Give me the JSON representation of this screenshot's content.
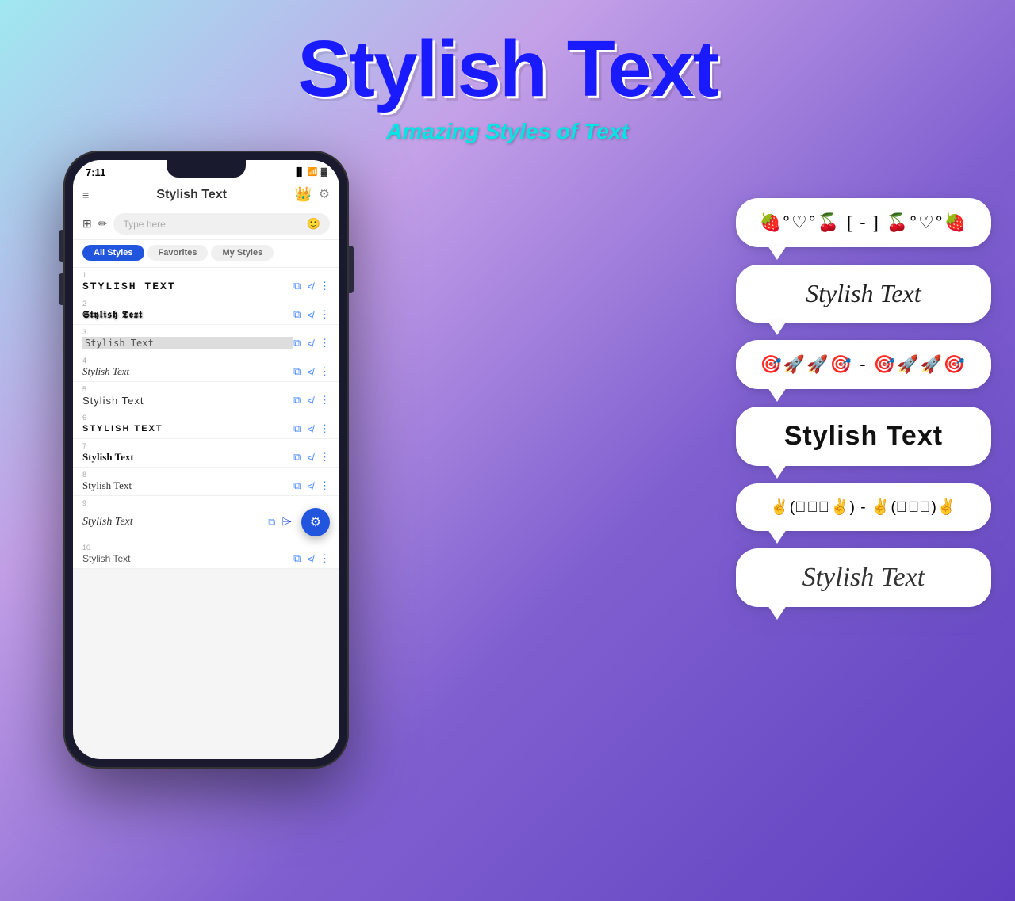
{
  "header": {
    "title": "Stylish Text",
    "subtitle": "Amazing Styles of Text"
  },
  "phone": {
    "status_time": "7:11",
    "app_name": "Stylish Text",
    "search_placeholder": "Type here",
    "tabs": [
      "All Styles",
      "Favorites",
      "My Styles"
    ],
    "styles": [
      {
        "num": "1",
        "text": "STYLISH TEXT",
        "class": "style-1"
      },
      {
        "num": "2",
        "text": "𝕾𝖙𝖞𝖑𝖎𝖘𝖍 𝕿𝖊𝖝𝖙",
        "class": "style-2"
      },
      {
        "num": "3",
        "text": "Stylish Text",
        "class": "style-3"
      },
      {
        "num": "4",
        "text": "Stylish Text",
        "class": "style-4"
      },
      {
        "num": "5",
        "text": "Stylish Text",
        "class": "style-5"
      },
      {
        "num": "6",
        "text": "STYLISH TEXT",
        "class": "style-6"
      },
      {
        "num": "7",
        "text": "Stylish Text",
        "class": "style-7"
      },
      {
        "num": "8",
        "text": "Stylish Text",
        "class": "style-8"
      },
      {
        "num": "9",
        "text": "Stylish Text",
        "class": "style-9"
      },
      {
        "num": "10",
        "text": "Stylish Text",
        "class": "style-10"
      }
    ]
  },
  "bubbles": [
    {
      "id": 1,
      "content": "🍓°♡°🍒 [ - ] 🍒°♡°🍓",
      "class": "bubble-text-1"
    },
    {
      "id": 2,
      "content": "Stylish Text",
      "class": "bubble-text-2"
    },
    {
      "id": 3,
      "content": "🎯🚀🚀🎯 - 🎯🚀🚀🎯",
      "class": "bubble-text-3"
    },
    {
      "id": 4,
      "content": "Stylish Text",
      "class": "bubble-text-4"
    },
    {
      "id": 5,
      "content": "✌(ﾟ◡ﾟ✌) - ✌(ﾟ◡ﾟ)✌",
      "class": "bubble-text-5"
    },
    {
      "id": 6,
      "content": "Stylish Text",
      "class": "bubble-text-6"
    }
  ],
  "colors": {
    "bg_start": "#a0e8f0",
    "bg_end": "#6040c0",
    "title_blue": "#1a1aff",
    "subtitle_cyan": "#00e5e5",
    "tab_active": "#2255DD"
  }
}
